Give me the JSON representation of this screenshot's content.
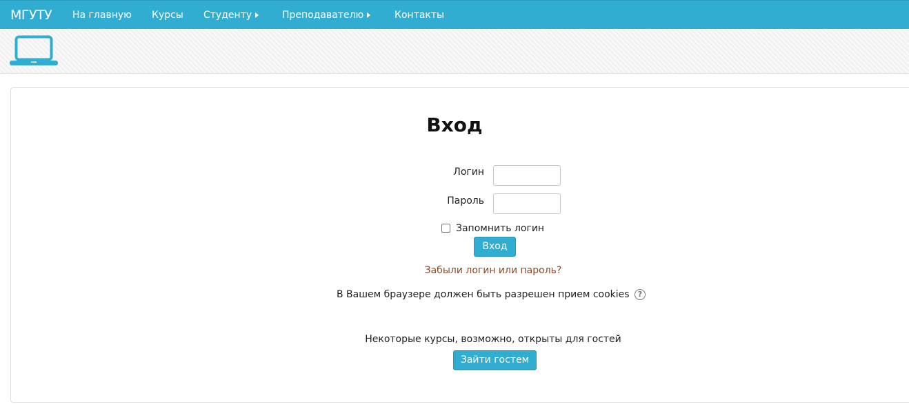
{
  "navbar": {
    "brand": "МГУТУ",
    "items": [
      {
        "label": "На главную"
      },
      {
        "label": "Курсы"
      },
      {
        "label": "Студенту",
        "has_submenu": true
      },
      {
        "label": "Преподавателю",
        "has_submenu": true
      },
      {
        "label": "Контакты"
      }
    ]
  },
  "header": {
    "logo_icon": "laptop-icon"
  },
  "login": {
    "title": "Вход",
    "username_label": "Логин",
    "username_value": "",
    "password_label": "Пароль",
    "password_value": "",
    "remember_label": "Запомнить логин",
    "remember_checked": false,
    "submit_label": "Вход",
    "forgot_link": "Забыли логин или пароль?",
    "cookies_notice": "В Вашем браузере должен быть разрешен прием cookies",
    "help_icon": "question-circle-icon",
    "guest_notice": "Некоторые курсы, возможно, открыты для гостей",
    "guest_button": "Зайти гостем"
  },
  "colors": {
    "accent": "#31add2",
    "link": "#8a4a28"
  }
}
